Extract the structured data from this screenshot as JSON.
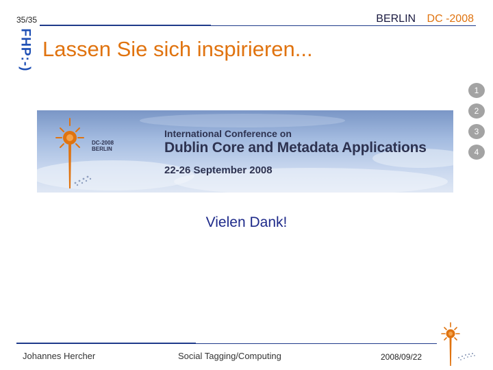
{
  "header": {
    "page_counter": "35/35",
    "city": "BERLIN",
    "event": "DC -2008",
    "logo_text": "FHP:-)"
  },
  "slide": {
    "title": "Lassen Sie sich inspirieren...",
    "thanks": "Vielen Dank!"
  },
  "nav": [
    "1",
    "2",
    "3",
    "4"
  ],
  "banner": {
    "badge_line_1": "DC-2008",
    "badge_line_2": "BERLIN",
    "line_1": "International Conference on",
    "line_2": "Dublin Core and Metadata Applications",
    "line_3": "22-26 September 2008"
  },
  "footer": {
    "author": "Johannes Hercher",
    "topic": "Social Tagging/Computing",
    "date": "2008/09/22"
  },
  "colors": {
    "accent_orange": "#e0730f",
    "rule_blue": "#1e3a8a",
    "text_dark_blue": "#1e2a8a",
    "nav_grey": "#a3a3a3"
  }
}
